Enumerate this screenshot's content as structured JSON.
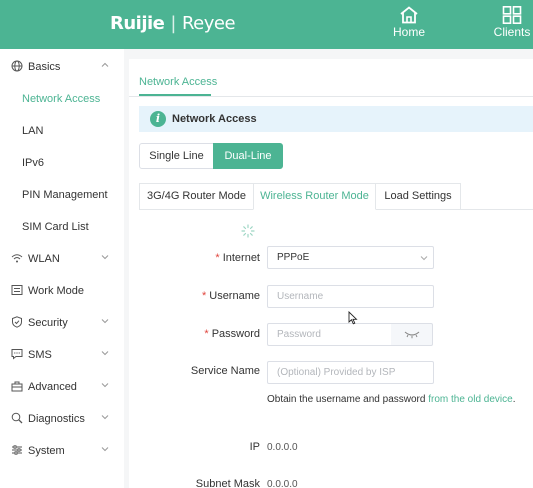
{
  "header": {
    "logo_brand": "Ruijie",
    "logo_separator": "|",
    "logo_product": "Reyee",
    "nav": [
      {
        "label": "Home",
        "icon": "home-icon"
      },
      {
        "label": "Clients",
        "icon": "clients-grid-icon"
      }
    ]
  },
  "sidebar": {
    "basics": {
      "label": "Basics",
      "icon": "globe-icon",
      "expanded": true
    },
    "basics_sub": [
      "Network Access",
      "LAN",
      "IPv6",
      "PIN Management",
      "SIM Card List"
    ],
    "active_sub": "Network Access",
    "items": [
      {
        "label": "WLAN",
        "icon": "wifi-icon"
      },
      {
        "label": "Work Mode",
        "icon": "work-mode-icon"
      },
      {
        "label": "Security",
        "icon": "shield-icon"
      },
      {
        "label": "SMS",
        "icon": "sms-icon"
      },
      {
        "label": "Advanced",
        "icon": "advanced-icon"
      },
      {
        "label": "Diagnostics",
        "icon": "diagnostics-icon"
      },
      {
        "label": "System",
        "icon": "system-icon"
      }
    ]
  },
  "main": {
    "page_tab": "Network Access",
    "info_title": "Network Access",
    "line_mode": {
      "options": [
        "Single Line",
        "Dual-Line"
      ],
      "selected": "Dual-Line"
    },
    "sub_tabs": {
      "options": [
        "3G/4G Router Mode",
        "Wireless Router Mode",
        "Load Settings"
      ],
      "active": "Wireless Router Mode"
    },
    "form": {
      "internet": {
        "label": "Internet",
        "required": true,
        "value": "PPPoE"
      },
      "username": {
        "label": "Username",
        "required": true,
        "value": "",
        "placeholder": "Username"
      },
      "password": {
        "label": "Password",
        "required": true,
        "value": "",
        "placeholder": "Password"
      },
      "service_name": {
        "label": "Service Name",
        "required": false,
        "value": "",
        "placeholder": "(Optional) Provided by ISP"
      }
    },
    "hint_text": "Obtain the username and password ",
    "hint_link": "from the old device",
    "hint_end": ".",
    "ip": {
      "label": "IP",
      "value": "0.0.0.0"
    },
    "subnet_mask": {
      "label": "Subnet Mask",
      "value": "0.0.0.0"
    }
  },
  "colors": {
    "accent": "#4cb493",
    "required": "#e0443c",
    "info_bg": "#e6f3fb"
  }
}
